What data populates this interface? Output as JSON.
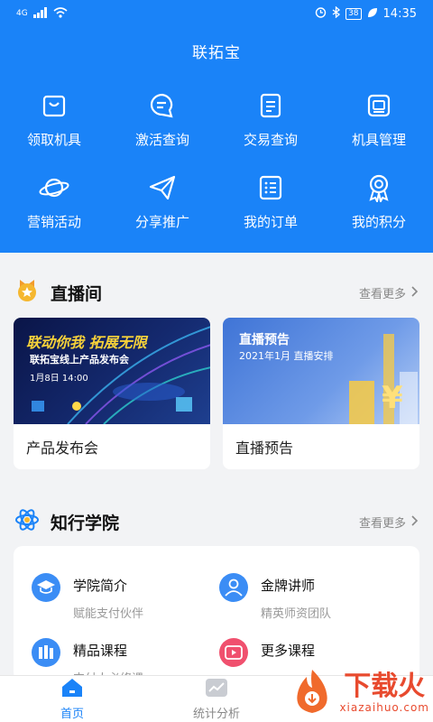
{
  "status": {
    "network": "4G",
    "battery": "38",
    "time": "14:35"
  },
  "app": {
    "title": "联拓宝"
  },
  "grid": [
    {
      "label": "领取机具",
      "icon": "bag-icon"
    },
    {
      "label": "激活查询",
      "icon": "chat-search-icon"
    },
    {
      "label": "交易查询",
      "icon": "document-icon"
    },
    {
      "label": "机具管理",
      "icon": "device-icon"
    },
    {
      "label": "营销活动",
      "icon": "planet-icon"
    },
    {
      "label": "分享推广",
      "icon": "send-icon"
    },
    {
      "label": "我的订单",
      "icon": "list-icon"
    },
    {
      "label": "我的积分",
      "icon": "award-icon"
    }
  ],
  "live": {
    "title": "直播间",
    "more": "查看更多",
    "cards": [
      {
        "banner_heading": "联动你我 拓展无限",
        "banner_sub": "联拓宝线上产品发布会",
        "banner_date": "1月8日  14:00",
        "caption": "产品发布会"
      },
      {
        "banner_heading": "直播预告",
        "banner_sub": "2021年1月  直播安排",
        "caption": "直播预告"
      }
    ]
  },
  "academy": {
    "title": "知行学院",
    "more": "查看更多",
    "items": [
      {
        "title": "学院简介",
        "sub": "赋能支付伙伴",
        "icon": "graduation-cap-icon"
      },
      {
        "title": "金牌讲师",
        "sub": "精英师资团队",
        "icon": "teacher-icon"
      },
      {
        "title": "精品课程",
        "sub": "支付人必修课",
        "icon": "books-icon"
      },
      {
        "title": "更多课程",
        "sub": "",
        "icon": "video-play-icon"
      }
    ]
  },
  "tabs": [
    {
      "label": "首页",
      "active": true
    },
    {
      "label": "统计分析",
      "active": false
    }
  ],
  "watermark": {
    "main": "下载火",
    "sub": "xiazaihuo.com"
  },
  "colors": {
    "primary": "#1a83f8",
    "watermark": "#e84a2e"
  }
}
